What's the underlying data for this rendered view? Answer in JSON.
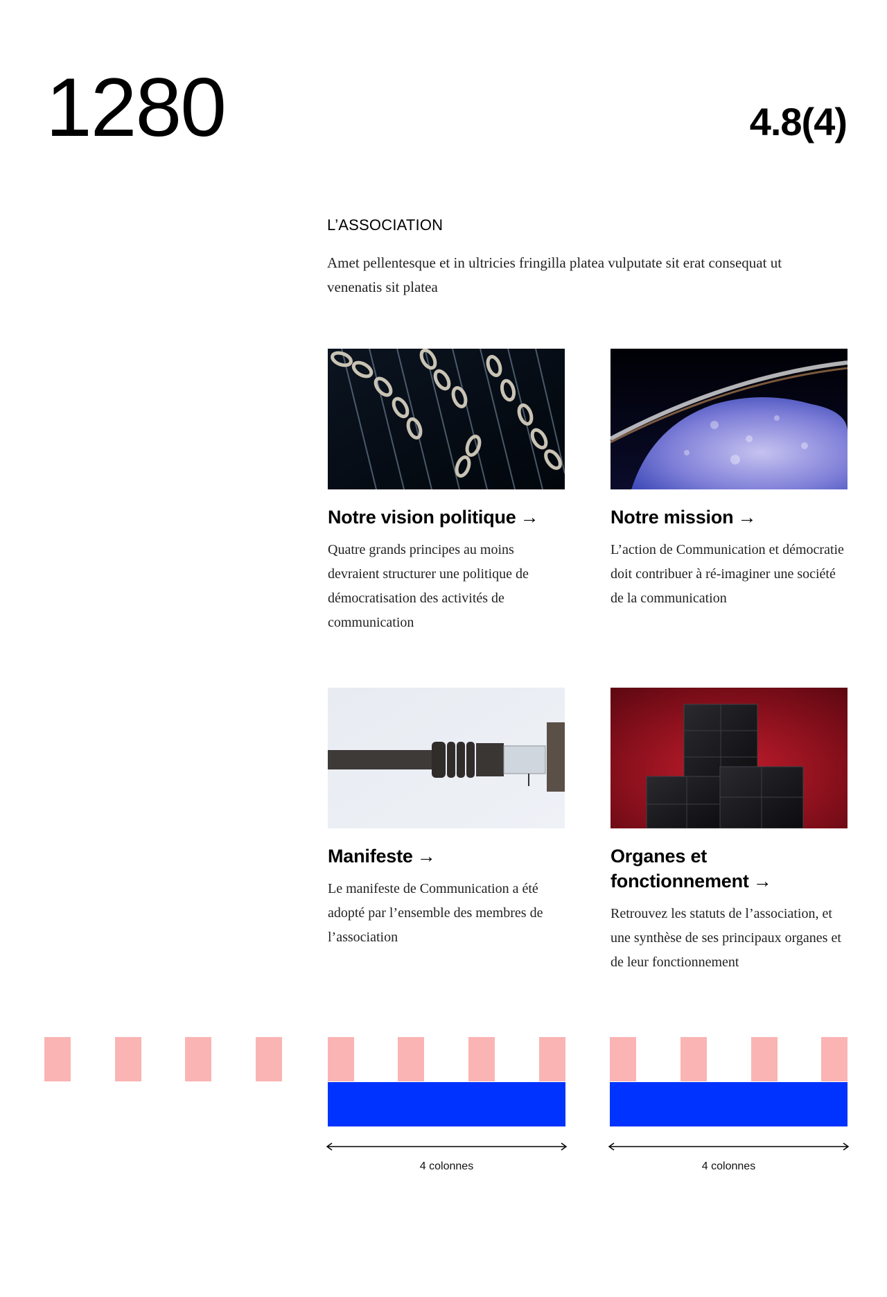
{
  "header": {
    "width_title": "1280",
    "version": "4.8(4)"
  },
  "section": {
    "label": "L’ASSOCIATION",
    "intro": "Amet pellentesque et in ultricies fringilla platea vulputate sit erat consequat ut venenatis sit platea"
  },
  "cards": [
    {
      "title": "Notre vision politique",
      "arrow": "→",
      "text": "Quatre grands principes au moins devraient structurer une politique de démocratisation des activités de communication",
      "image": "chains-image"
    },
    {
      "title": "Notre mission",
      "arrow": "→",
      "text": "L’action de Communication et démocratie doit contribuer à ré-imaginer une société de la communication",
      "image": "planet-image"
    },
    {
      "title": "Manifeste",
      "arrow": "→",
      "text": "Le manifeste de Communication a été adopté par l’ensemble des membres de  l’association",
      "image": "cable-image"
    },
    {
      "title": "Organes et fonctionnement",
      "arrow": "→",
      "text": "Retrouvez les statuts de l’association, et une synthèse de ses principaux organes et de leur fonctionnement",
      "image": "cubes-image"
    }
  ],
  "grid_overlay": {
    "column_color": "#fbb4b4",
    "span_color": "#0033ff",
    "span_labels": [
      "4 colonnes",
      "4 colonnes"
    ]
  }
}
